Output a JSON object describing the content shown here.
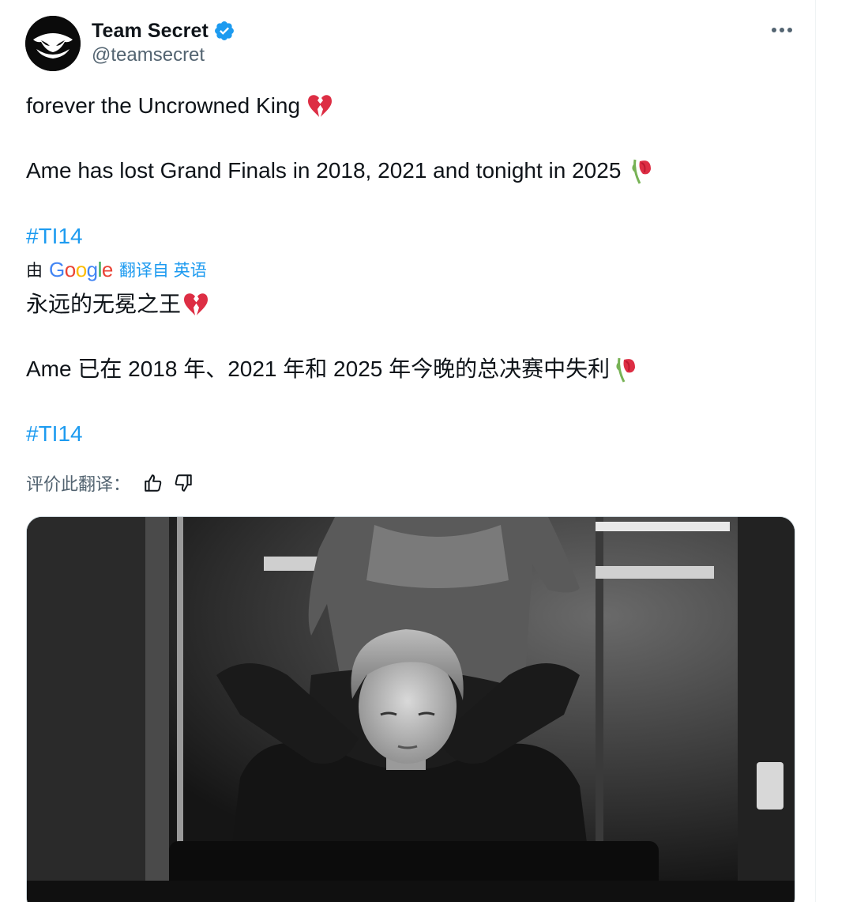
{
  "author": {
    "display_name": "Team Secret",
    "handle": "@teamsecret",
    "verified": true,
    "avatar_icon": "team-secret-logo",
    "verified_color": "#1d9bf0"
  },
  "menu": {
    "more_icon": "more-options-icon"
  },
  "original": {
    "line1": "forever the Uncrowned King",
    "line2": "Ame has lost Grand Finals in 2018, 2021 and tonight in 2025",
    "hashtag": "#TI14"
  },
  "translation": {
    "by_label": "由",
    "provider": "Google",
    "link_label": "翻译自 英语",
    "line1": "永远的无冕之王",
    "line2": "Ame 已在 2018 年、2021 年和 2025 年今晚的总决赛中失利",
    "hashtag": "#TI14"
  },
  "rating": {
    "label": "评价此翻译：",
    "thumbs_up_icon": "thumbs-up-icon",
    "thumbs_down_icon": "thumbs-down-icon"
  },
  "colors": {
    "link": "#1d9bf0",
    "text": "#0f1419",
    "secondary": "#536471"
  }
}
